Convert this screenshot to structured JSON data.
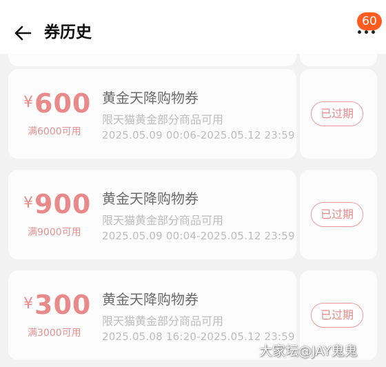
{
  "header": {
    "title": "券历史",
    "badge_count": "60"
  },
  "coupons": [
    {
      "currency": "¥",
      "amount": "600",
      "condition": "满6000可用",
      "name": "黄金天降购物券",
      "scope": "限天猫黄金部分商品可用",
      "period": "2025.05.09 00:06-2025.05.12 23:59",
      "status": "已过期"
    },
    {
      "currency": "¥",
      "amount": "900",
      "condition": "满9000可用",
      "name": "黄金天降购物券",
      "scope": "限天猫黄金部分商品可用",
      "period": "2025.05.09 00:04-2025.05.12 23:59",
      "status": "已过期"
    },
    {
      "currency": "¥",
      "amount": "300",
      "condition": "满3000可用",
      "name": "黄金天降购物券",
      "scope": "限天猫黄金部分商品可用",
      "period": "2025.05.08 16:20-2025.05.12 23:59",
      "status": "已过期"
    }
  ],
  "watermark": "大家坛@JAY鬼鬼",
  "icons": {
    "back": "arrow-left-icon",
    "more": "more-dots-icon"
  },
  "colors": {
    "accent": "#e88a8a",
    "badge": "#ff5a1f"
  }
}
